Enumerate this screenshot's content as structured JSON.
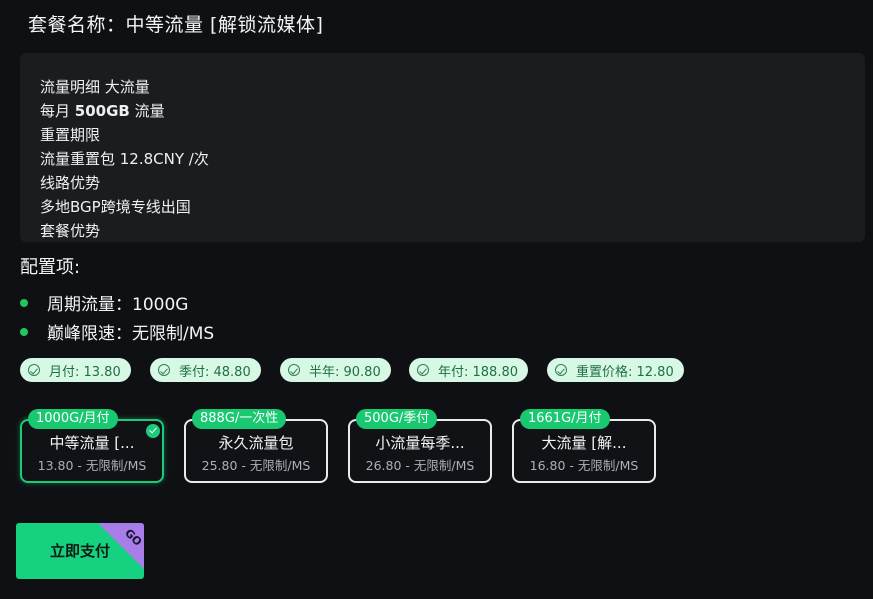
{
  "header": {
    "title": "套餐名称：中等流量 [解锁流媒体]"
  },
  "description": {
    "lines": [
      "流量明细 大流量",
      "每月 ",
      "500GB",
      " 流量",
      "重置期限",
      "流量重置包 12.8CNY /次",
      "线路优势",
      "多地BGP跨境专线出国",
      "套餐优势"
    ]
  },
  "config": {
    "title": "配置项:",
    "items": [
      "周期流量：1000G",
      "巅峰限速：无限制/MS"
    ],
    "accent_color": "#22c55e"
  },
  "prices": [
    {
      "label": "月付: 13.80",
      "icon": "check-circle-icon"
    },
    {
      "label": "季付: 48.80",
      "icon": "check-circle-icon"
    },
    {
      "label": "半年: 90.80",
      "icon": "check-circle-icon"
    },
    {
      "label": "年付: 188.80",
      "icon": "check-circle-icon"
    },
    {
      "label": "重置价格: 12.80",
      "icon": "check-circle-icon"
    }
  ],
  "packages": [
    {
      "tag": "1000G/月付",
      "name": "中等流量 [...",
      "sub": "13.80 - 无限制/MS",
      "selected": true
    },
    {
      "tag": "888G/一次性",
      "name": "永久流量包",
      "sub": "25.80 - 无限制/MS",
      "selected": false
    },
    {
      "tag": "500G/季付",
      "name": "小流量每季...",
      "sub": "26.80 - 无限制/MS",
      "selected": false
    },
    {
      "tag": "1661G/月付",
      "name": "大流量 [解...",
      "sub": "16.80 - 无限制/MS",
      "selected": false
    }
  ],
  "pay": {
    "label": "立即支付",
    "corner": "GO"
  },
  "colors": {
    "brand_green": "#16d17f",
    "tag_green": "#19c971",
    "corner_purple": "#a87de8",
    "background": "#0f1014"
  }
}
